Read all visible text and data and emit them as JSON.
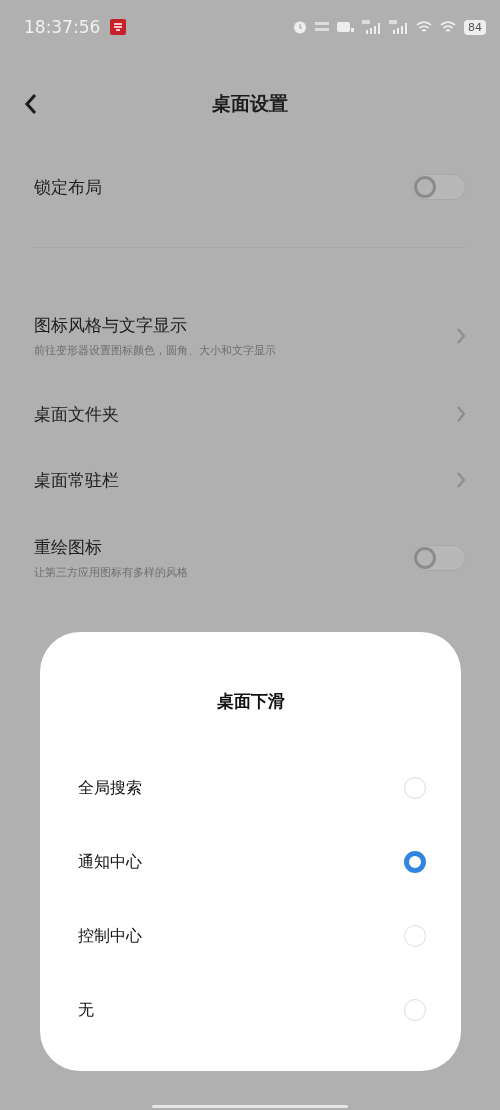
{
  "status_bar": {
    "time": "18:37:56",
    "battery": "84"
  },
  "header": {
    "title": "桌面设置"
  },
  "settings": [
    {
      "kind": "toggle",
      "title": "锁定布局",
      "on": false
    },
    {
      "kind": "divider"
    },
    {
      "kind": "link",
      "title": "图标风格与文字显示",
      "subtitle": "前往变形器设置图标颜色，圆角、大小和文字显示"
    },
    {
      "kind": "link",
      "title": "桌面文件夹"
    },
    {
      "kind": "link",
      "title": "桌面常驻栏"
    },
    {
      "kind": "toggle",
      "title": "重绘图标",
      "subtitle": "让第三方应用图标有多样的风格",
      "on": false
    }
  ],
  "dialog": {
    "title": "桌面下滑",
    "options": [
      {
        "label": "全局搜索",
        "selected": false
      },
      {
        "label": "通知中心",
        "selected": true
      },
      {
        "label": "控制中心",
        "selected": false
      },
      {
        "label": "无",
        "selected": false
      }
    ]
  }
}
